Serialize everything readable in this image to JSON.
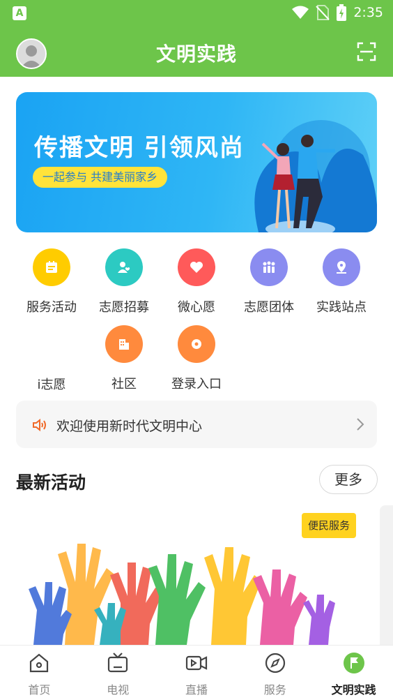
{
  "status_bar": {
    "time": "2:35",
    "app_icon_letter": "A"
  },
  "header": {
    "title": "文明实践",
    "avatar_icon": "avatar-icon",
    "scan_icon": "scan-icon"
  },
  "banner": {
    "title": "传播文明 引领风尚",
    "subtitle": "一起参与 共建美丽家乡"
  },
  "grid": {
    "items": [
      {
        "label": "服务活动",
        "icon": "calendar-icon",
        "color": "#ffcc00"
      },
      {
        "label": "志愿招募",
        "icon": "user-heart-icon",
        "color": "#2ccac2"
      },
      {
        "label": "微心愿",
        "icon": "heart-icon",
        "color": "#ff5a5a"
      },
      {
        "label": "志愿团体",
        "icon": "group-icon",
        "color": "#8a8cf0"
      },
      {
        "label": "实践站点",
        "icon": "location-icon",
        "color": "#8a8cf0"
      },
      {
        "label": "i志愿",
        "icon": "",
        "color": ""
      },
      {
        "label": "社区",
        "icon": "building-icon",
        "color": "#ff8a3d"
      },
      {
        "label": "登录入口",
        "icon": "login-icon",
        "color": "#ff8a3d"
      }
    ]
  },
  "notice": {
    "text": "欢迎使用新时代文明中心"
  },
  "section": {
    "title": "最新活动",
    "more_label": "更多"
  },
  "activity": {
    "badge": "便民服务"
  },
  "bottom_nav": {
    "items": [
      {
        "label": "首页",
        "icon": "home-icon"
      },
      {
        "label": "电视",
        "icon": "tv-icon"
      },
      {
        "label": "直播",
        "icon": "live-icon"
      },
      {
        "label": "服务",
        "icon": "compass-icon"
      },
      {
        "label": "文明实践",
        "icon": "flag-icon"
      }
    ],
    "active_index": 4
  },
  "colors": {
    "brand_green": "#6dc54a",
    "banner_blue": "#1aa3f3",
    "pill_yellow": "#ffe33a"
  }
}
